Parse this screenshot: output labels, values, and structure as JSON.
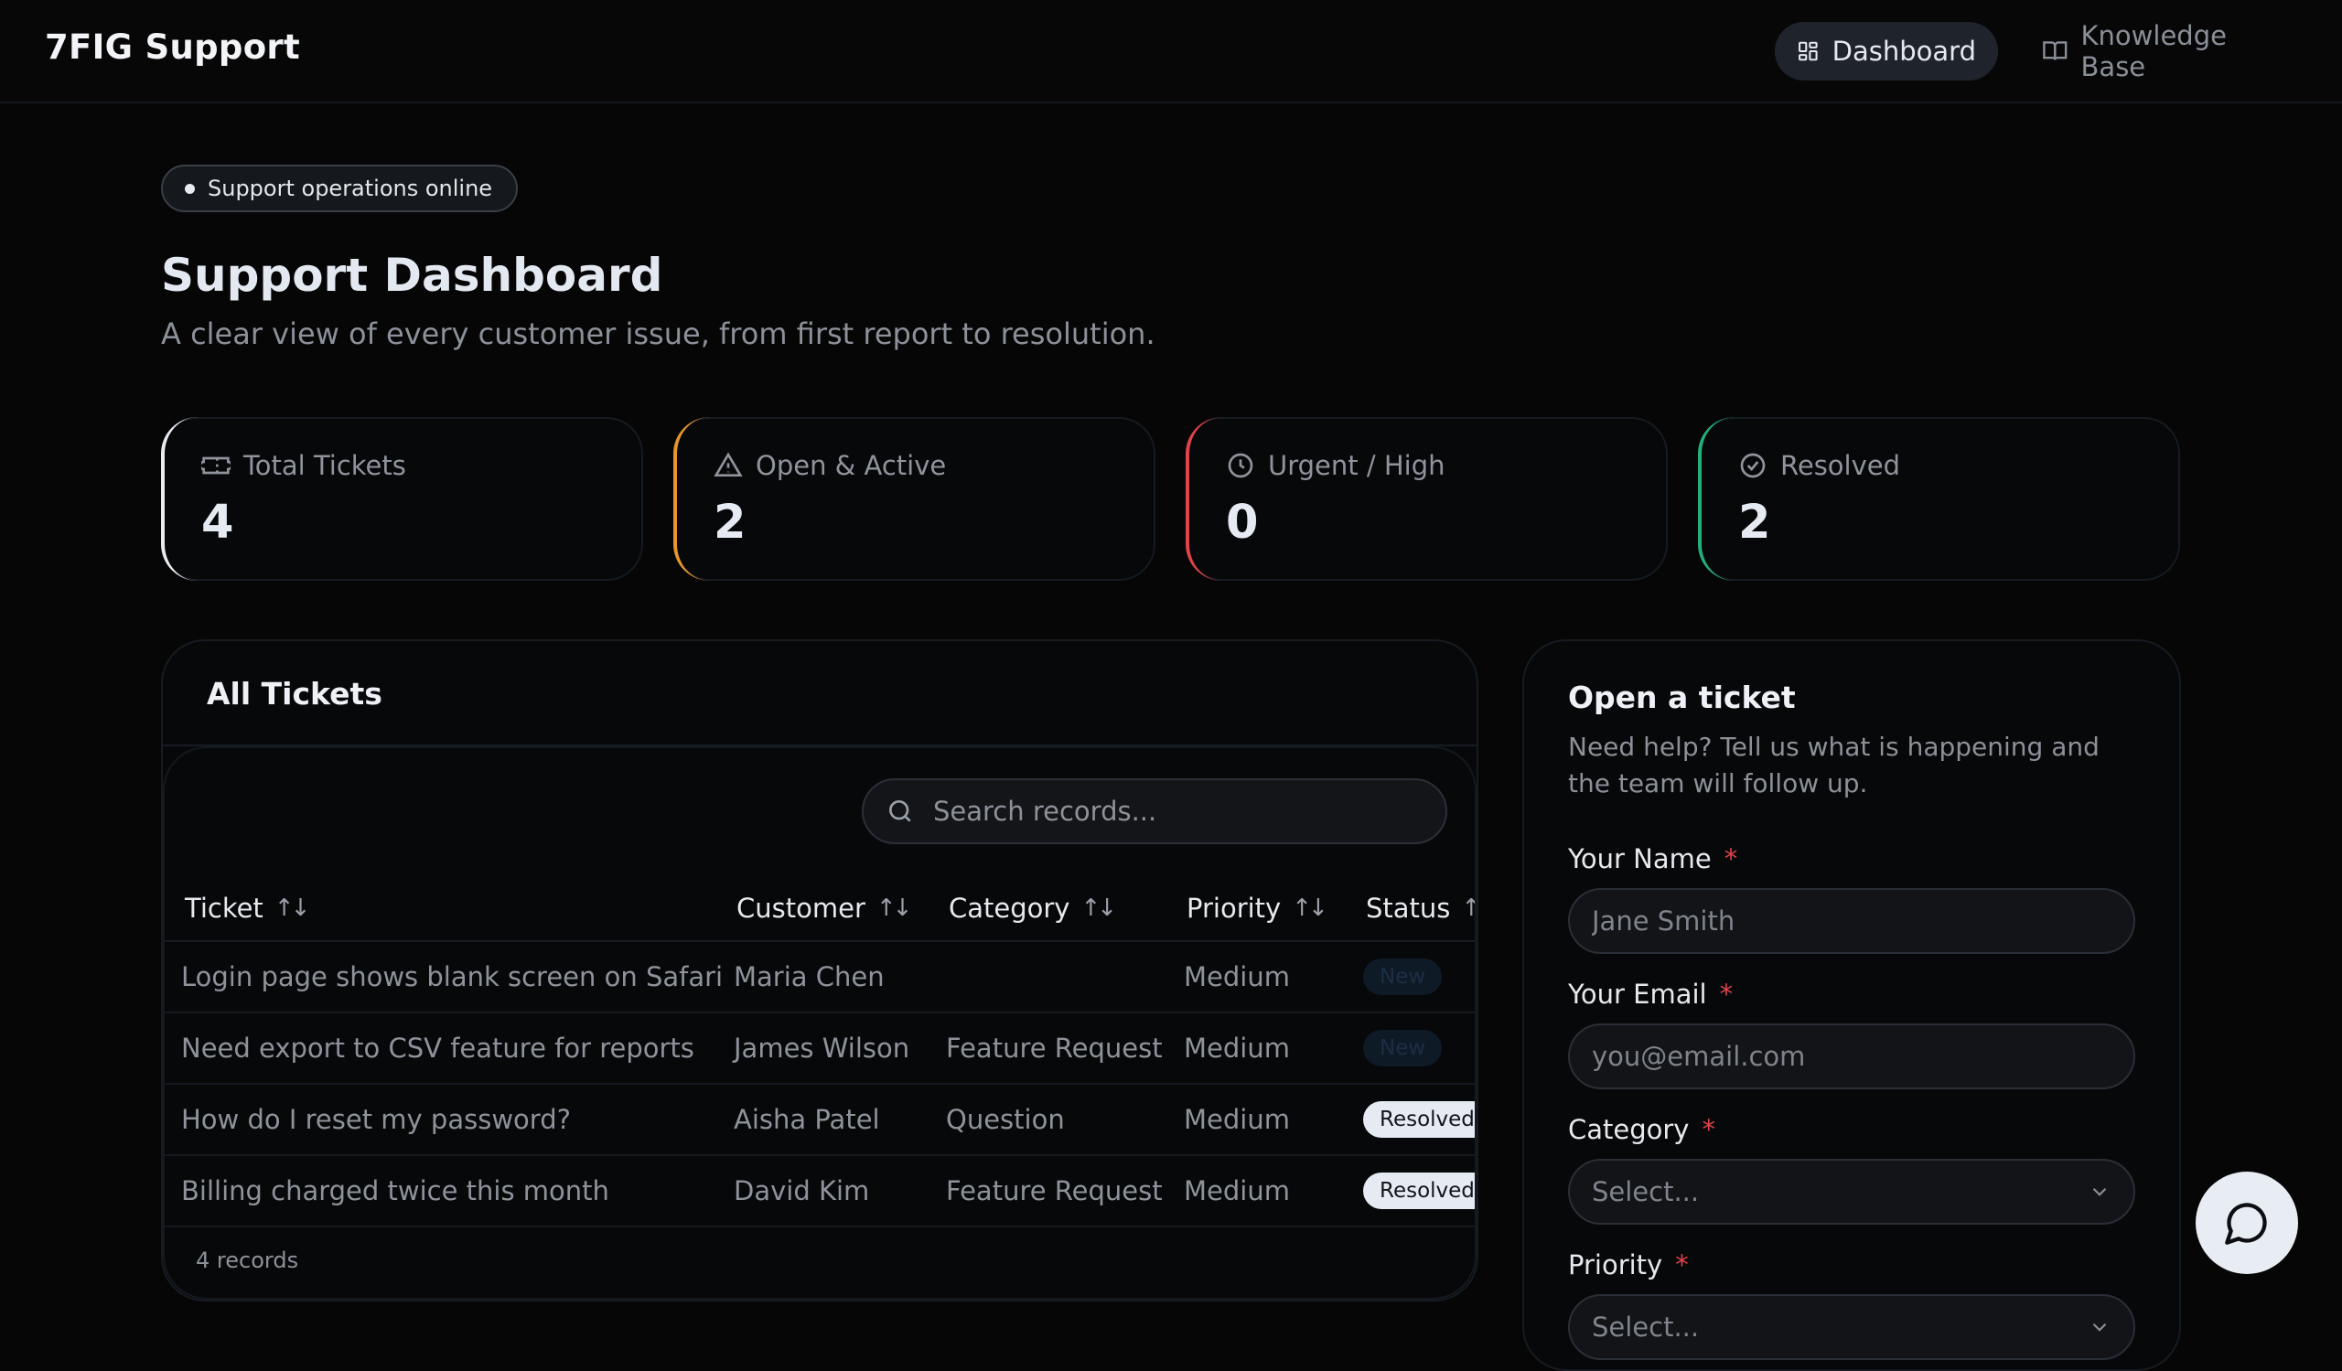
{
  "header": {
    "brand": "7FIG Support",
    "nav": [
      {
        "label": "Dashboard",
        "icon": "dashboard-grid-icon",
        "active": true
      },
      {
        "label": "Knowledge Base",
        "icon": "book-open-icon",
        "active": false
      }
    ]
  },
  "status_pill": "Support operations online",
  "page": {
    "title": "Support Dashboard",
    "subtitle": "A clear view of every customer issue, from first report to resolution."
  },
  "stats": [
    {
      "label": "Total Tickets",
      "value": "4",
      "icon": "ticket-icon",
      "accent": "#e8ecf3"
    },
    {
      "label": "Open & Active",
      "value": "2",
      "icon": "warning-triangle-icon",
      "accent": "#e8962b"
    },
    {
      "label": "Urgent / High",
      "value": "0",
      "icon": "clock-icon",
      "accent": "#e0434a"
    },
    {
      "label": "Resolved",
      "value": "2",
      "icon": "check-circle-icon",
      "accent": "#22b07d"
    }
  ],
  "tickets": {
    "title": "All Tickets",
    "search_placeholder": "Search records...",
    "columns": [
      "Ticket",
      "Customer",
      "Category",
      "Priority",
      "Status"
    ],
    "rows": [
      {
        "ticket": "Login page shows blank screen on Safari",
        "customer": "Maria Chen",
        "category": "",
        "priority": "Medium",
        "status": "New"
      },
      {
        "ticket": "Need export to CSV feature for reports",
        "customer": "James Wilson",
        "category": "Feature Request",
        "priority": "Medium",
        "status": "New"
      },
      {
        "ticket": "How do I reset my password?",
        "customer": "Aisha Patel",
        "category": "Question",
        "priority": "Medium",
        "status": "Resolved"
      },
      {
        "ticket": "Billing charged twice this month",
        "customer": "David Kim",
        "category": "Feature Request",
        "priority": "Medium",
        "status": "Resolved"
      }
    ],
    "footer": "4 records"
  },
  "form": {
    "title": "Open a ticket",
    "subtitle": "Need help? Tell us what is happening and the team will follow up.",
    "required_mark": "*",
    "name_label": "Your Name",
    "name_placeholder": "Jane Smith",
    "email_label": "Your Email",
    "email_placeholder": "you@email.com",
    "category_label": "Category",
    "category_value": "Select...",
    "priority_label": "Priority",
    "priority_value": "Select..."
  },
  "chat_button_icon": "chat-bubble-icon"
}
